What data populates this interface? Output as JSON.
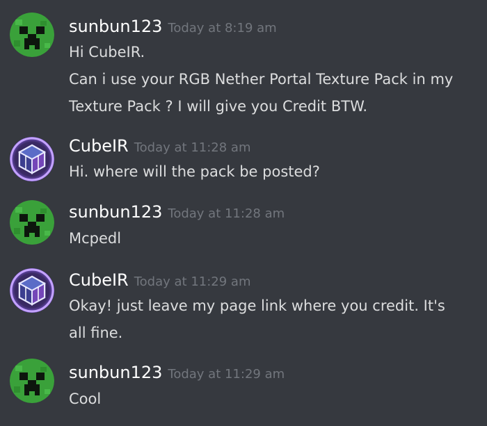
{
  "colors": {
    "background": "#36393f",
    "username": "#ffffff",
    "timestamp": "#72767d",
    "message_text": "#dcddde",
    "creeper_green": "#3aa13a",
    "cube_avatar_glow": "#9b6cff"
  },
  "messages": [
    {
      "author": "sunbun123",
      "avatar_icon": "creeper-face-icon",
      "timestamp": "Today at 8:19 am",
      "lines": [
        "Hi CubeIR.",
        "Can i use your RGB Nether Portal Texture Pack in my",
        "Texture Pack ? I will give you Credit BTW."
      ]
    },
    {
      "author": "CubeIR",
      "avatar_icon": "cube-logo-icon",
      "timestamp": "Today at 11:28 am",
      "lines": [
        "Hi. where will the pack be posted?"
      ]
    },
    {
      "author": "sunbun123",
      "avatar_icon": "creeper-face-icon",
      "timestamp": "Today at 11:28 am",
      "lines": [
        "Mcpedl"
      ]
    },
    {
      "author": "CubeIR",
      "avatar_icon": "cube-logo-icon",
      "timestamp": "Today at 11:29 am",
      "lines": [
        "Okay! just leave my page link where you credit. It's",
        "all fine."
      ]
    },
    {
      "author": "sunbun123",
      "avatar_icon": "creeper-face-icon",
      "timestamp": "Today at 11:29 am",
      "lines": [
        "Cool"
      ]
    }
  ]
}
